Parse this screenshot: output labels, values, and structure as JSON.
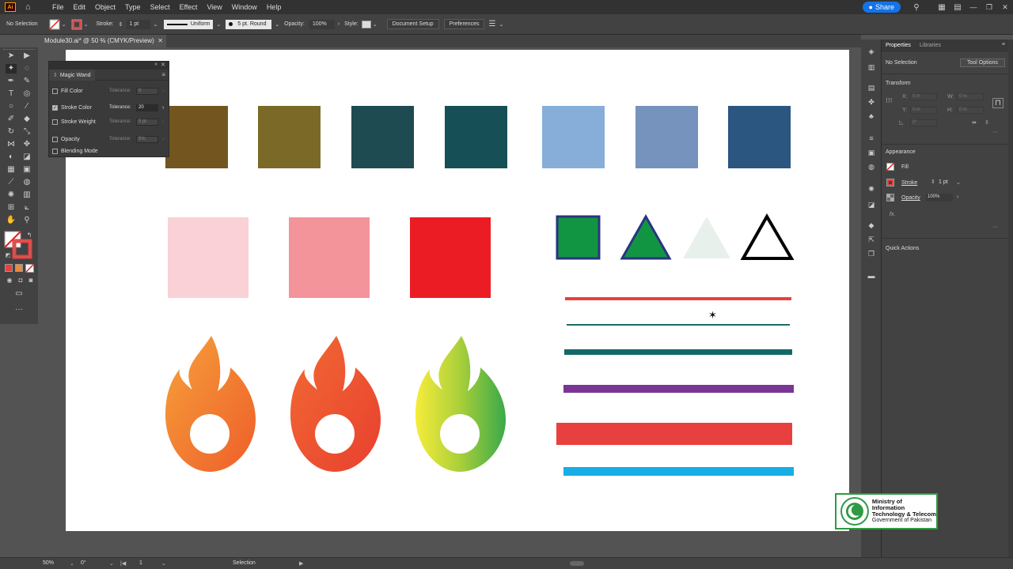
{
  "app": {
    "icon_text": "Ai",
    "menus": [
      "File",
      "Edit",
      "Object",
      "Type",
      "Select",
      "Effect",
      "View",
      "Window",
      "Help"
    ],
    "share_label": "Share"
  },
  "control": {
    "selection": "No Selection",
    "stroke_label": "Stroke:",
    "stroke_weight": "1 pt",
    "profile": "Uniform",
    "brush": "5 pt. Round",
    "opacity_label": "Opacity:",
    "opacity_value": "100%",
    "style_label": "Style:",
    "document_setup": "Document Setup",
    "preferences": "Preferences"
  },
  "document": {
    "tab_title": "Module30.ai* @ 50 % (CMYK/Preview)"
  },
  "magic_wand": {
    "title": "Magic Wand",
    "rows": [
      {
        "label": "Fill Color",
        "checked": false,
        "tol_label": "Tolerance:",
        "tol": "0",
        "enabled": false
      },
      {
        "label": "Stroke Color",
        "checked": true,
        "tol_label": "Tolerance:",
        "tol": "20",
        "enabled": true
      },
      {
        "label": "Stroke Weight",
        "checked": false,
        "tol_label": "Tolerance:",
        "tol": "5 pt",
        "enabled": false
      },
      {
        "label": "Opacity",
        "checked": false,
        "tol_label": "Tolerance:",
        "tol": "5%",
        "enabled": false
      },
      {
        "label": "Blending Mode",
        "checked": false
      }
    ]
  },
  "properties": {
    "tab_properties": "Properties",
    "tab_libraries": "Libraries",
    "selection": "No Selection",
    "tool_options": "Tool Options",
    "transform_title": "Transform",
    "x_label": "X:",
    "y_label": "Y:",
    "w_label": "W:",
    "h_label": "H:",
    "x_placeholder": "0 in",
    "y_placeholder": "0 in",
    "w_placeholder": "0 in",
    "h_placeholder": "0 in",
    "angle_placeholder": "0°",
    "appearance_title": "Appearance",
    "fill_label": "Fill",
    "stroke_label": "Stroke",
    "stroke_value": "1 pt",
    "opacity_label": "Opacity",
    "opacity_value": "100%",
    "fx_label": "fx.",
    "quick_actions": "Quick Actions"
  },
  "status": {
    "zoom": "50%",
    "rotation": "0°",
    "artboard": "1",
    "tool": "Selection"
  },
  "watermark": {
    "line1": "Ministry of Information",
    "line2": "Technology & Telecom",
    "line3": "Government of Pakistan"
  },
  "artwork_colors": {
    "row1": [
      "#73561f",
      "#7b6a27",
      "#1e4a52",
      "#164f55",
      "#87aed9",
      "#7593bc",
      "#2a5680"
    ],
    "row2": [
      "#f9d1d6",
      "#f3939a",
      "#ec1c24"
    ],
    "shapes": {
      "square_fill": "#129543",
      "square_stroke": "#2a3482",
      "triangle_fill": "#129543",
      "triangle_stroke": "#2a3482",
      "pale_triangle": "#e8f0ec",
      "outline_triangle": "#000000"
    },
    "lines": [
      "#e8403f",
      "#1b6b66",
      "#136966",
      "#7b3594",
      "#e8403f",
      "#18aee5"
    ]
  }
}
